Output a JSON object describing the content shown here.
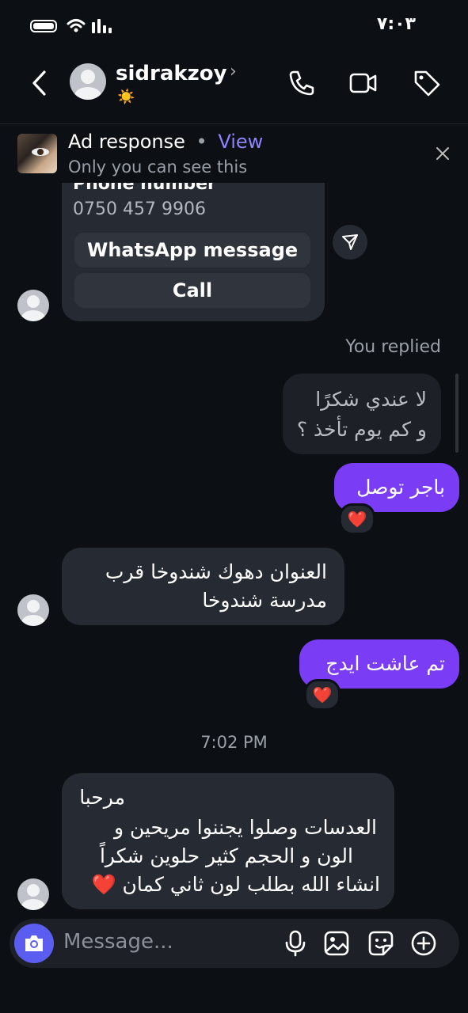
{
  "status_bar": {
    "time": "٧:٠٣"
  },
  "header": {
    "username": "sidrakzoy",
    "chevron": "›",
    "status_emoji": "☀️",
    "icons": [
      "back-icon",
      "phone-icon",
      "video-icon",
      "tag-icon"
    ]
  },
  "ad_banner": {
    "title": "Ad response",
    "separator": "•",
    "view_label": "View",
    "subtitle": "Only you can see this"
  },
  "contact_card": {
    "phone_label": "Phone number",
    "phone_number": "0750 457 9906",
    "whatsapp_label": "WhatsApp message",
    "call_label": "Call"
  },
  "thread": {
    "you_replied": "You replied",
    "replied_line1": "لا عندي شكرًا",
    "replied_line2": "و كم يوم تأخذ ؟",
    "msg_sent_1": "باجر توصل",
    "msg_recv_1_line1": "العنوان دهوك شندوخا قرب",
    "msg_recv_1_line2": "مدرسة شندوخا",
    "msg_sent_2": "تم عاشت ايدج",
    "timestamp": "7:02 PM",
    "msg_recv_2_line1": "مرحبا",
    "msg_recv_2_line2": "العدسات وصلوا يجننوا مريحين و",
    "msg_recv_2_line3": "الون و الحجم كثير حلوين شكراً",
    "msg_recv_2_line4": "انشاء الله بطلب لون ثاني كمان ❤️",
    "reaction": "❤️"
  },
  "composer": {
    "placeholder": "Message..."
  },
  "colors": {
    "background": "#0c0f14",
    "bubble_received": "#262a32",
    "bubble_sent": "#7a3cf5",
    "accent": "#8f84ff",
    "camera_button": "#5a5df0"
  }
}
